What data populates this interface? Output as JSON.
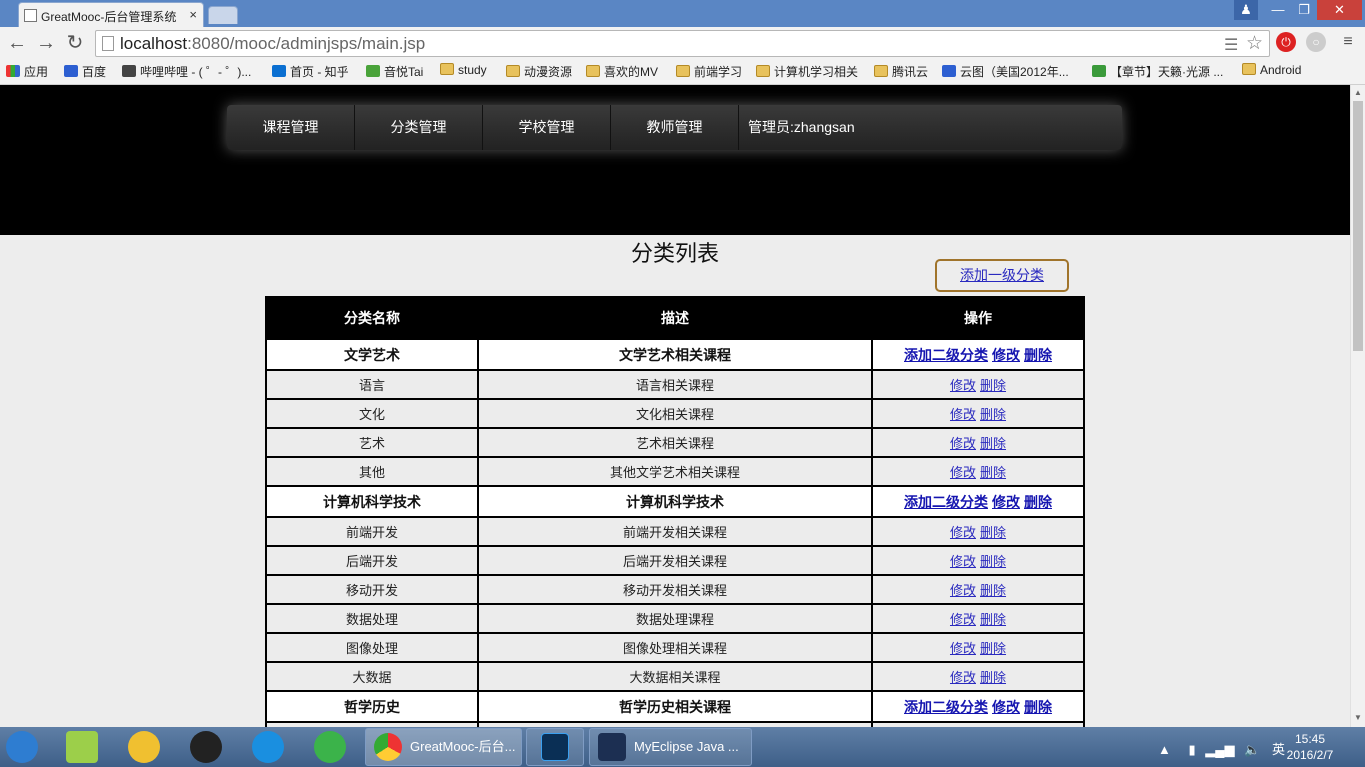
{
  "browser": {
    "tab_title": "GreatMooc-后台管理系统",
    "tab_close": "×",
    "url_host": "localhost",
    "url_rest": ":8080/mooc/adminjsps/main.jsp"
  },
  "bookmarks": [
    {
      "label": "应用",
      "icon": "apps-grid-icon"
    },
    {
      "label": "百度",
      "icon": "baidu-icon"
    },
    {
      "label": "哔哩哔哩 - ( ゜- ゜)...",
      "icon": "bilibili-icon"
    },
    {
      "label": "首页 - 知乎",
      "icon": "zhihu-icon"
    },
    {
      "label": "音悦Tai",
      "icon": "yinyuetai-icon"
    },
    {
      "label": "study",
      "icon": "folder-icon"
    },
    {
      "label": "动漫资源",
      "icon": "folder-icon"
    },
    {
      "label": "喜欢的MV",
      "icon": "folder-icon"
    },
    {
      "label": "前端学习",
      "icon": "folder-icon"
    },
    {
      "label": "计算机学习相关",
      "icon": "folder-icon"
    },
    {
      "label": "腾讯云",
      "icon": "folder-icon"
    },
    {
      "label": "云图（美国2012年...",
      "icon": "baidu-icon"
    },
    {
      "label": "【章节】天籁·光源 ...",
      "icon": "book-icon"
    },
    {
      "label": "Android",
      "icon": "folder-icon"
    }
  ],
  "nav": {
    "items": [
      "课程管理",
      "分类管理",
      "学校管理",
      "教师管理"
    ],
    "admin": "管理员:zhangsan"
  },
  "page": {
    "title": "分类列表",
    "add_top": "添加一级分类",
    "headers": [
      "分类名称",
      "描述",
      "操作"
    ],
    "actions": {
      "add_sub": "添加二级分类",
      "edit": "修改",
      "delete": "删除"
    },
    "rows": [
      {
        "parent": true,
        "name": "文学艺术",
        "desc": "文学艺术相关课程"
      },
      {
        "parent": false,
        "name": "语言",
        "desc": "语言相关课程"
      },
      {
        "parent": false,
        "name": "文化",
        "desc": "文化相关课程"
      },
      {
        "parent": false,
        "name": "艺术",
        "desc": "艺术相关课程"
      },
      {
        "parent": false,
        "name": "其他",
        "desc": "其他文学艺术相关课程"
      },
      {
        "parent": true,
        "name": "计算机科学技术",
        "desc": "计算机科学技术"
      },
      {
        "parent": false,
        "name": "前端开发",
        "desc": "前端开发相关课程"
      },
      {
        "parent": false,
        "name": "后端开发",
        "desc": "后端开发相关课程"
      },
      {
        "parent": false,
        "name": "移动开发",
        "desc": "移动开发相关课程"
      },
      {
        "parent": false,
        "name": "数据处理",
        "desc": "数据处理课程"
      },
      {
        "parent": false,
        "name": "图像处理",
        "desc": "图像处理相关课程"
      },
      {
        "parent": false,
        "name": "大数据",
        "desc": "大数据相关课程"
      },
      {
        "parent": true,
        "name": "哲学历史",
        "desc": "哲学历史相关课程"
      },
      {
        "parent": false,
        "name": "",
        "desc": ""
      }
    ]
  },
  "taskbar": {
    "windows": [
      "GreatMooc-后台...",
      "MyEclipse Java ..."
    ],
    "ime": "英",
    "time": "15:45",
    "date": "2016/2/7"
  }
}
